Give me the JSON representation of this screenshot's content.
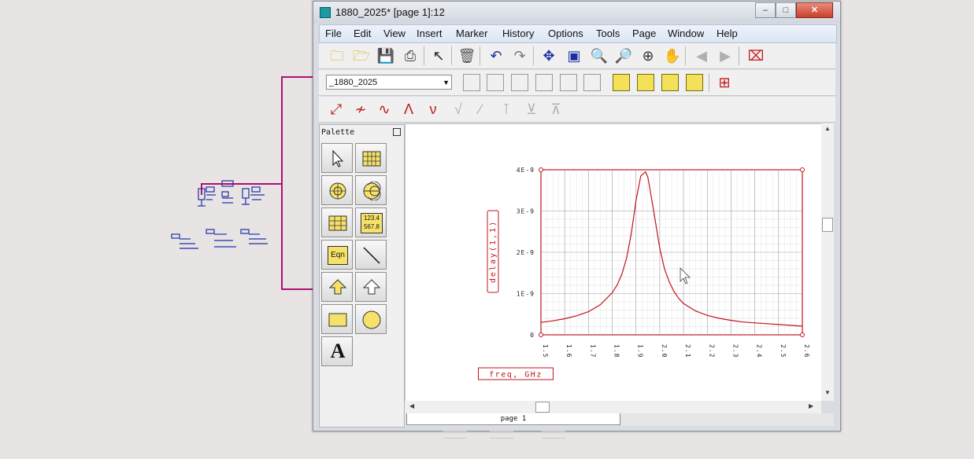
{
  "window": {
    "title": "1880_2025* [page 1]:12"
  },
  "menubar": {
    "items": [
      "File",
      "Edit",
      "View",
      "Insert",
      "Marker",
      "History",
      "Options",
      "Tools",
      "Page",
      "Window",
      "Help"
    ]
  },
  "toolbar": {
    "icons": [
      "open-folder-icon",
      "open-icon",
      "save-icon",
      "print-icon",
      "pointer-icon",
      "delete-icon",
      "undo-icon",
      "redo-icon",
      "move-icon",
      "zoom-box-icon",
      "zoom-in-icon",
      "zoom-out-icon",
      "zoom-fit-icon",
      "pan-icon",
      "prev-icon",
      "next-icon",
      "stop-icon"
    ],
    "page_select": "_1880_2025"
  },
  "palette": {
    "title": "Palette",
    "items": [
      "select-icon",
      "rectangular-plot-icon",
      "polar-plot-icon",
      "smith-chart-icon",
      "list-icon",
      "stacked-table-icon",
      "equation-icon",
      "line-icon",
      "polyline-icon",
      "polygon-icon",
      "rectangle-icon",
      "circle-icon",
      "text-icon"
    ],
    "table_label": "123.4 567.8",
    "eqn_label": "Eqn",
    "text_label": "A"
  },
  "page_tab": {
    "label": "page 1"
  },
  "chart_data": {
    "type": "line",
    "xlabel": "freq, GHz",
    "ylabel": "delay(1,1)",
    "xlim": [
      1.5,
      2.6
    ],
    "ylim": [
      0,
      4e-09
    ],
    "xticks": [
      "1.5",
      "1.6",
      "1.7",
      "1.8",
      "1.9",
      "2.0",
      "2.1",
      "2.2",
      "2.3",
      "2.4",
      "2.5",
      "2.6"
    ],
    "yticks": [
      "0",
      "1E-9",
      "2E-9",
      "3E-9",
      "4E-9"
    ],
    "grid": true,
    "line_color": "#c0141e",
    "series": [
      {
        "x": [
          1.5,
          1.55,
          1.6,
          1.65,
          1.7,
          1.75,
          1.8,
          1.82,
          1.84,
          1.86,
          1.88,
          1.9,
          1.92,
          1.94,
          1.95,
          1.96,
          1.98,
          2.0,
          2.02,
          2.04,
          2.06,
          2.08,
          2.1,
          2.15,
          2.2,
          2.25,
          2.3,
          2.35,
          2.4,
          2.45,
          2.5,
          2.55,
          2.6
        ],
        "y": [
          3e-10,
          3.4e-10,
          3.9e-10,
          4.6e-10,
          5.6e-10,
          7.3e-10,
          1.02e-09,
          1.2e-09,
          1.46e-09,
          1.85e-09,
          2.45e-09,
          3.25e-09,
          3.85e-09,
          3.95e-09,
          3.82e-09,
          3.5e-09,
          2.8e-09,
          2.1e-09,
          1.6e-09,
          1.28e-09,
          1.05e-09,
          8.8e-10,
          7.6e-10,
          5.8e-10,
          4.7e-10,
          4e-10,
          3.5e-10,
          3.1e-10,
          2.9e-10,
          2.7e-10,
          2.5e-10,
          2.3e-10,
          2.1e-10
        ]
      }
    ]
  }
}
